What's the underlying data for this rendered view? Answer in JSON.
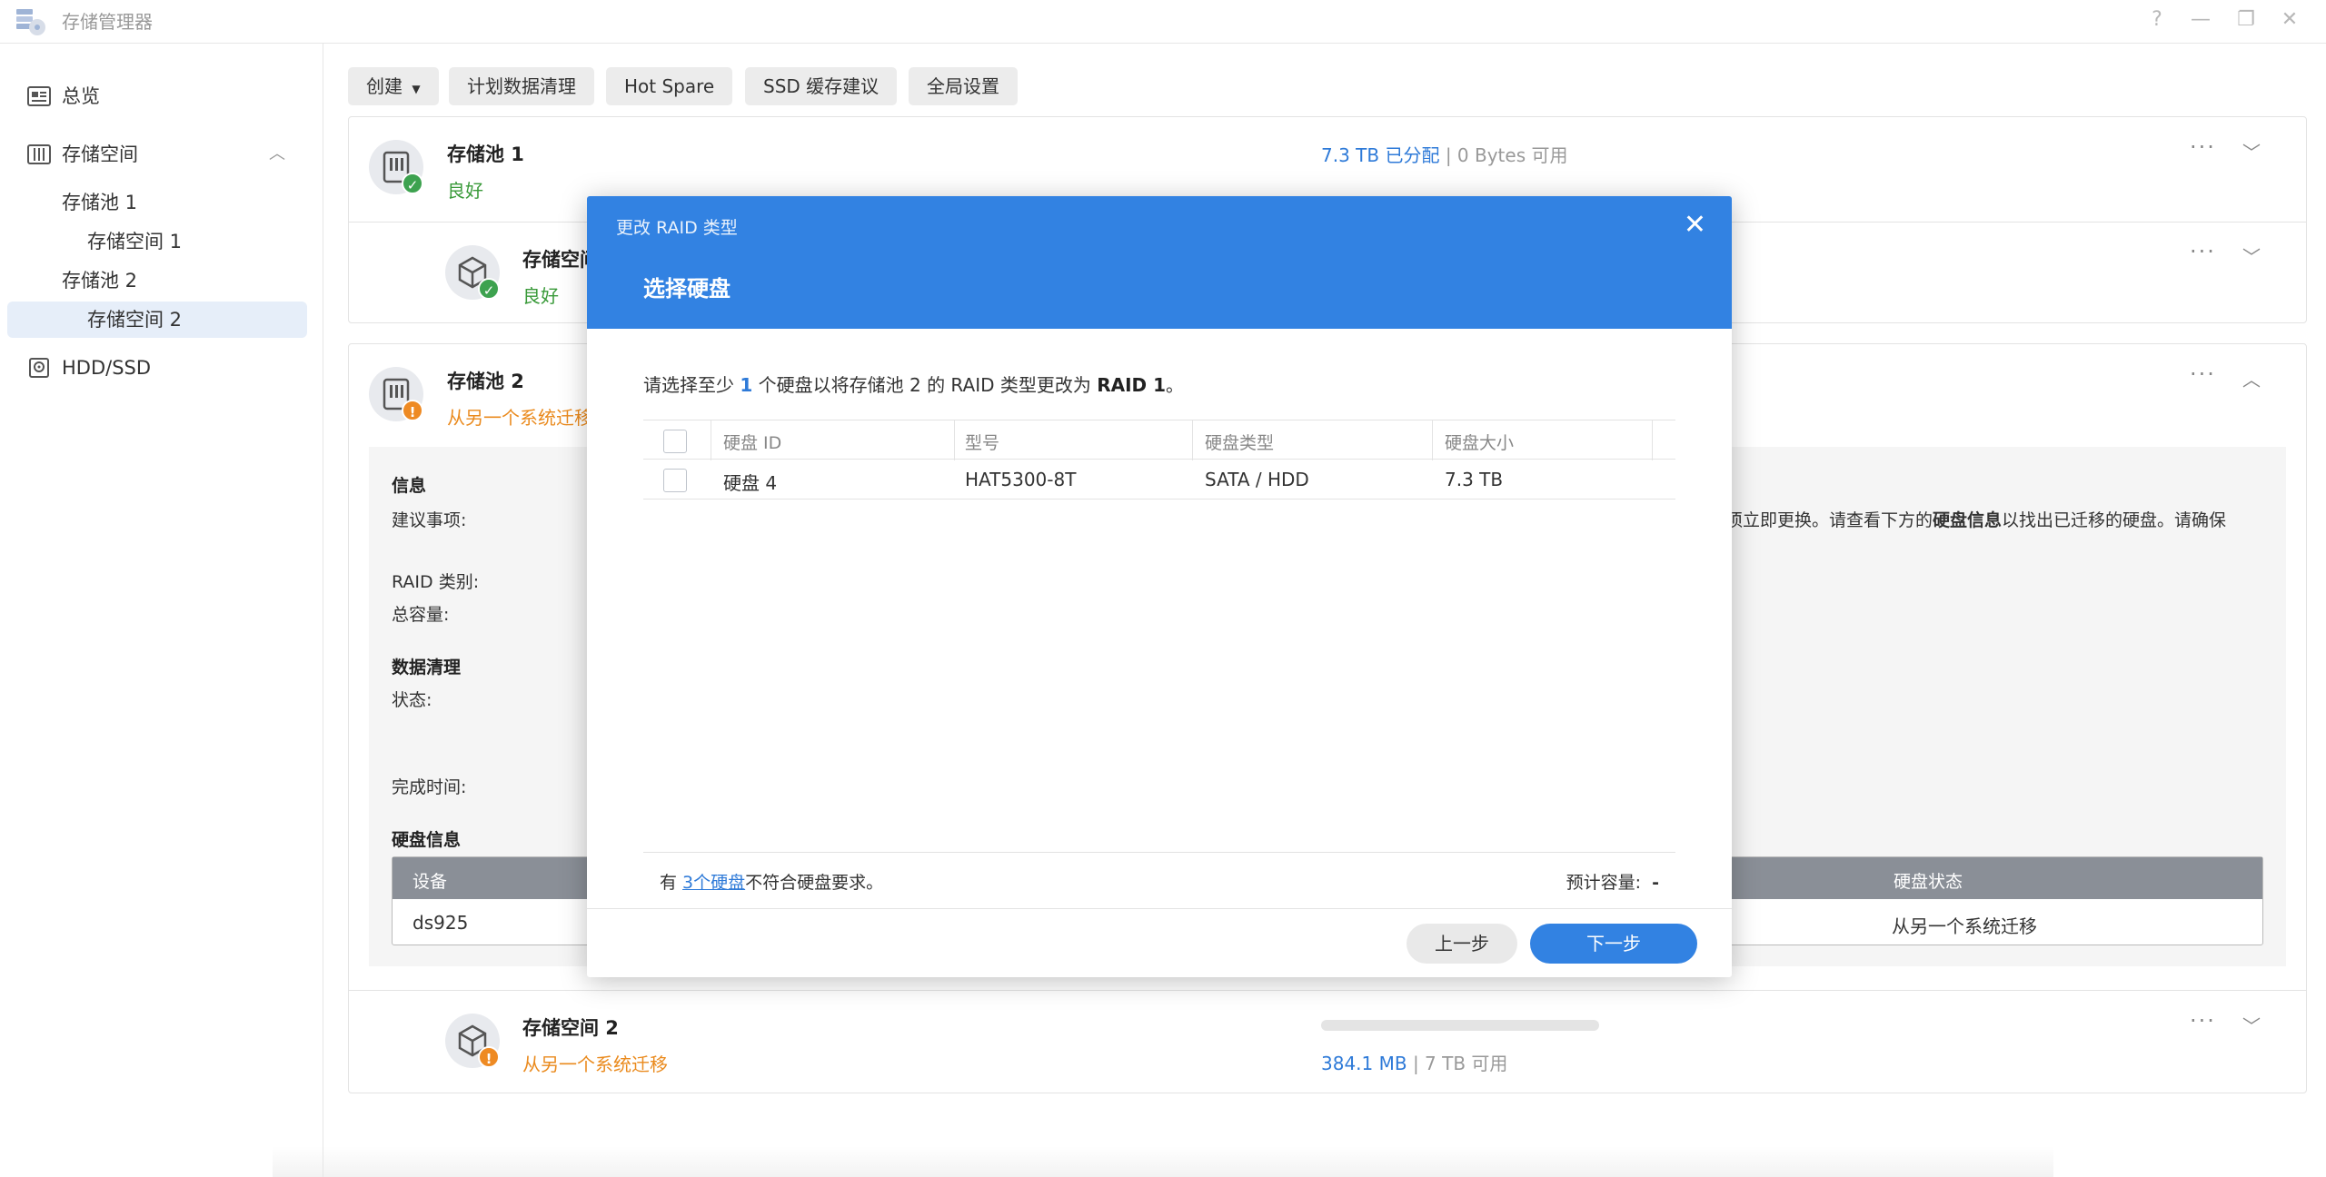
{
  "window": {
    "title": "存储管理器",
    "controls": [
      "?",
      "—",
      "❐",
      "✕"
    ]
  },
  "sidebar": {
    "overview": "总览",
    "storage": "存储空间",
    "pool1": "存储池 1",
    "volume1": "存储空间 1",
    "pool2": "存储池 2",
    "volume2": "存储空间 2",
    "hdd": "HDD/SSD"
  },
  "toolbar": {
    "create": "创建",
    "scrub": "计划数据清理",
    "hotspare": "Hot Spare",
    "ssd": "SSD 缓存建议",
    "settings": "全局设置"
  },
  "pool1": {
    "title": "存储池 1",
    "status": "良好",
    "allocated": "7.3 TB 已分配",
    "sep": " | ",
    "available": "0 Bytes 可用"
  },
  "volume1": {
    "title": "存储空间",
    "status": "良好"
  },
  "pool2": {
    "title": "存储池 2",
    "status": "从另一个系统迁移",
    "info_head": "信息",
    "advice_label": "建议事项:",
    "advice_text_pre": "必须立即更换。请查看下方的",
    "advice_text_bold": "硬盘信息",
    "advice_text_post": "以找出已迁移的硬盘。请确保",
    "raid_label": "RAID 类别:",
    "capacity_label": "总容量:",
    "scrub_head": "数据清理",
    "state_label": "状态:",
    "finish_label": "完成时间:",
    "disk_head": "硬盘信息",
    "disk_table": {
      "col_device": "设备",
      "col_status": "硬盘状态",
      "device": "ds925",
      "status": "从另一个系统迁移"
    }
  },
  "volume2": {
    "title": "存储空间 2",
    "status": "从另一个系统迁移",
    "used": "384.1 MB",
    "sep": " | ",
    "available": "7 TB 可用",
    "usage_fraction": 0.0
  },
  "modal": {
    "small_title": "更改 RAID 类型",
    "big_title": "选择硬盘",
    "instr_pre": "请选择至少 ",
    "instr_num": "1",
    "instr_mid": " 个硬盘以将存储池 2 的 RAID 类型更改为 ",
    "instr_raid": "RAID 1",
    "instr_post": "。",
    "columns": [
      "硬盘 ID",
      "型号",
      "硬盘类型",
      "硬盘大小"
    ],
    "rows": [
      {
        "id": "硬盘 4",
        "model": "HAT5300-8T",
        "type": "SATA / HDD",
        "size": "7.3 TB"
      }
    ],
    "footer_pre": "有 ",
    "footer_link": "3个硬盘",
    "footer_post": "不符合硬盘要求。",
    "capacity_label": "预计容量:",
    "capacity_value": "-",
    "prev": "上一步",
    "next": "下一步"
  }
}
